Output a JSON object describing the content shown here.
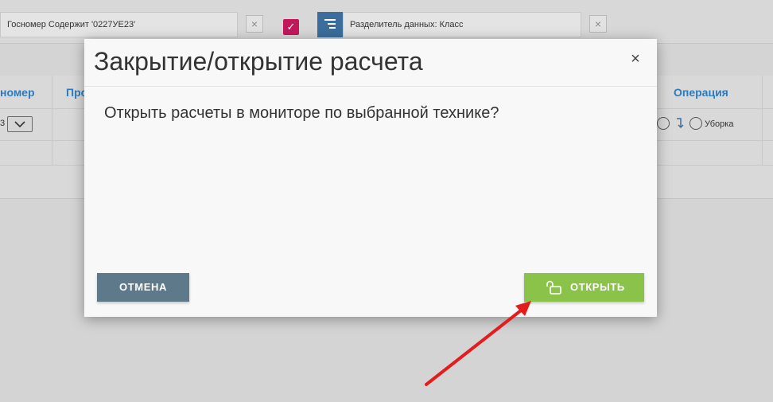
{
  "filters": {
    "filter1": "Госномер Содержит '0227УЕ23'",
    "filter2": "Разделитель данных: Класс",
    "close_glyph": "×",
    "check_glyph": "✓"
  },
  "grid": {
    "columns": [
      "номер",
      "Про",
      "Операция"
    ],
    "row1": {
      "plate_tail": "3",
      "operation": "Уборка"
    }
  },
  "modal": {
    "title": "Закрытие/открытие расчета",
    "close_glyph": "×",
    "message": "Открыть расчеты в мониторе по выбранной технике?",
    "cancel_label": "ОТМЕНА",
    "open_label": "ОТКРЫТЬ"
  },
  "colors": {
    "accent_blue": "#2b7bbf",
    "open_green": "#8bc34a",
    "cancel_slate": "#5e7a8a",
    "checkbox_pink": "#c2185b",
    "arrow_red": "#e31c1c"
  }
}
